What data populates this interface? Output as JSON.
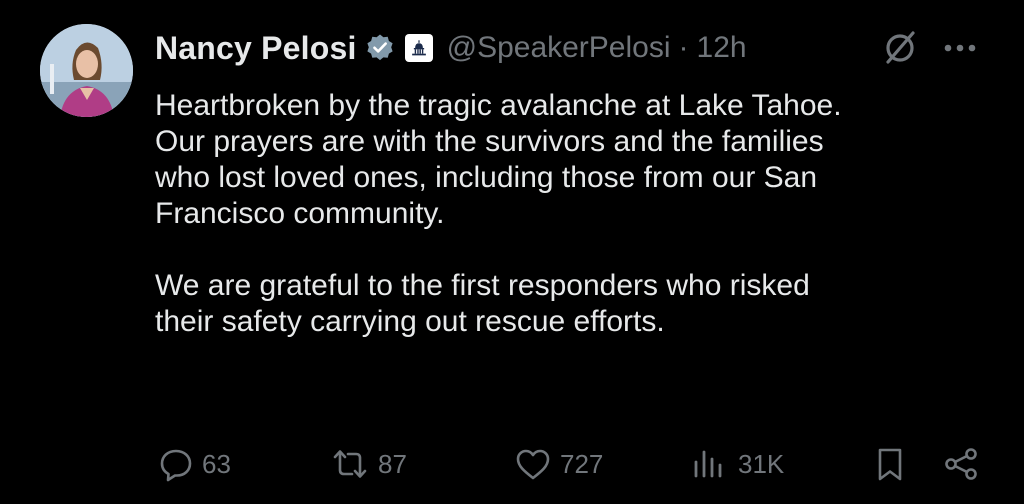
{
  "author": {
    "name": "Nancy Pelosi",
    "handle": "@SpeakerPelosi",
    "separator": "·",
    "time": "12h",
    "verified_icon": "verified-badge-icon",
    "affiliate_icon": "capitol-badge-icon"
  },
  "tweet": {
    "paragraphs": [
      {
        "lines": [
          "Heartbroken by the tragic avalanche at Lake Tahoe.",
          "Our prayers are with the survivors and the families",
          "who lost loved ones, including those from our San",
          "Francisco community."
        ]
      },
      {
        "lines": [
          "We are grateful to the first responders who risked",
          "their safety carrying out rescue efforts."
        ]
      }
    ]
  },
  "actions": {
    "replies": "63",
    "reposts": "87",
    "likes": "727",
    "views": "31K"
  },
  "colors": {
    "background": "#000000",
    "text": "#e7e9ea",
    "muted": "#71767b",
    "verified": "#829aab"
  }
}
